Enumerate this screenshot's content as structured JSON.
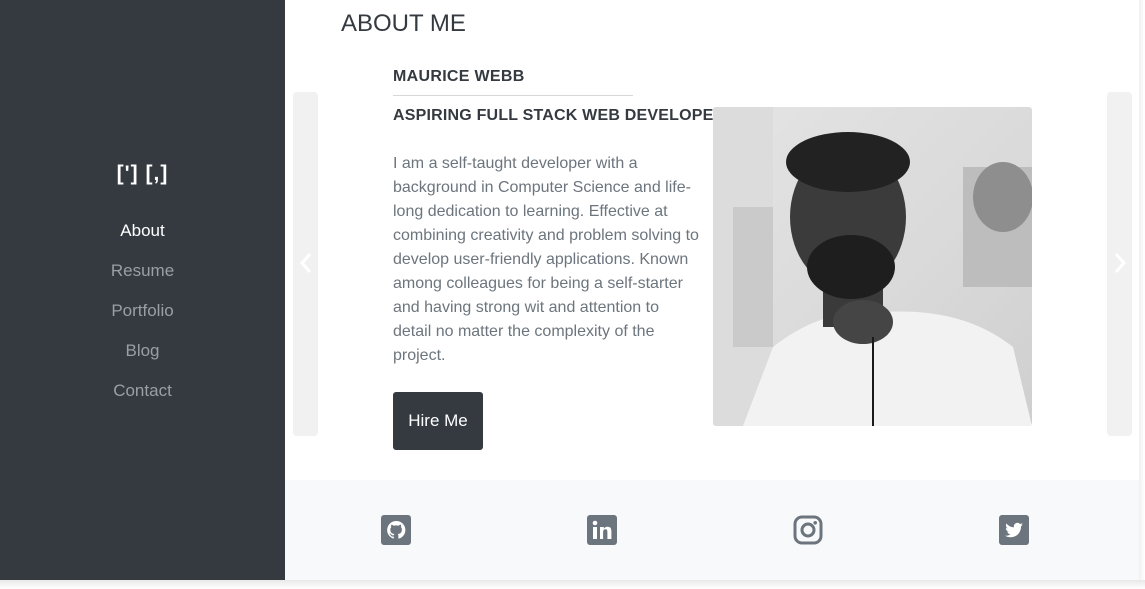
{
  "sidebar": {
    "logo": "['] [,]",
    "nav": [
      {
        "label": "About",
        "active": true
      },
      {
        "label": "Resume",
        "active": false
      },
      {
        "label": "Portfolio",
        "active": false
      },
      {
        "label": "Blog",
        "active": false
      },
      {
        "label": "Contact",
        "active": false
      }
    ]
  },
  "main": {
    "title": "ABOUT ME",
    "name": "MAURICE WEBB",
    "role": "ASPIRING FULL STACK WEB DEVELOPER",
    "bio": "I am a self-taught developer with a background in Computer Science and life-long dedication to learning. Effective at combining creativity and problem solving to develop user-friendly applications. Known among colleagues for being a self-starter and having strong wit and attention to detail no matter the complexity of the project.",
    "hire_label": "Hire Me",
    "carousel": {
      "prev_icon": "chevron-left-icon",
      "next_icon": "chevron-right-icon"
    }
  },
  "footer": {
    "social": [
      {
        "name": "github-icon"
      },
      {
        "name": "linkedin-icon"
      },
      {
        "name": "instagram-icon"
      },
      {
        "name": "twitter-icon"
      }
    ]
  },
  "colors": {
    "sidebar_bg": "#343a40",
    "accent_dark": "#343a40",
    "muted_text": "#6c757d",
    "footer_bg": "#f8f9fa",
    "icon_color": "#6c757d"
  }
}
